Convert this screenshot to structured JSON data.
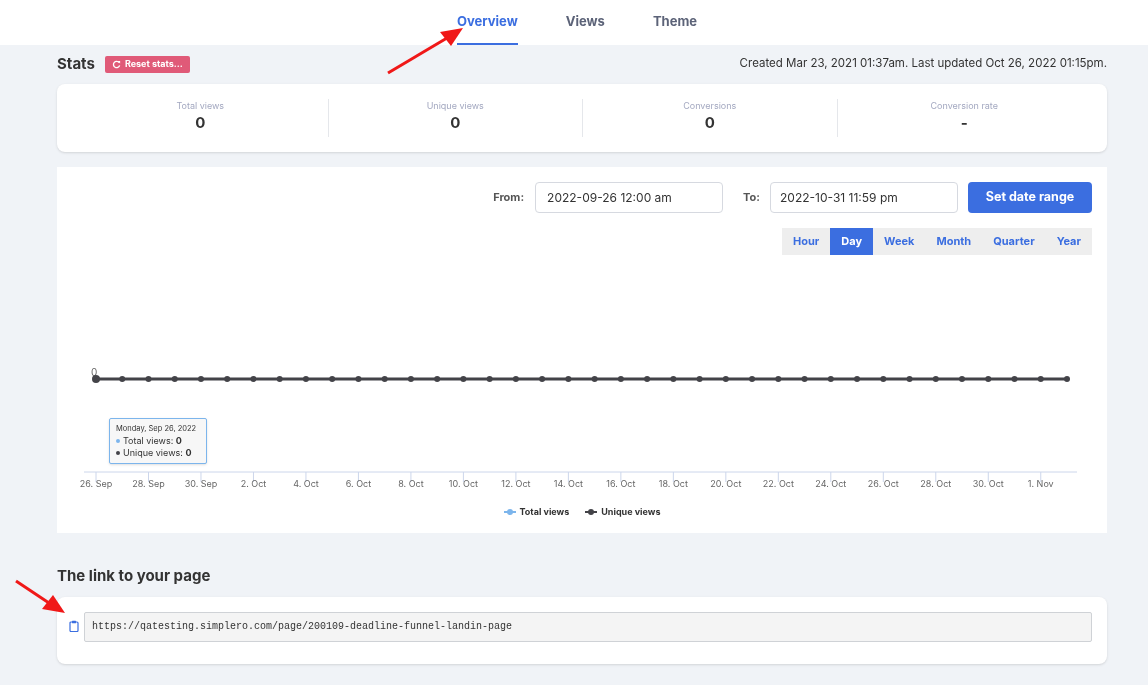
{
  "tabs": [
    {
      "label": "Overview",
      "selected": true
    },
    {
      "label": "Views",
      "selected": false
    },
    {
      "label": "Theme",
      "selected": false
    }
  ],
  "stats": {
    "title": "Stats",
    "reset_button": "Reset stats...",
    "meta": "Created Mar 23, 2021 01:37am. Last updated Oct 26, 2022 01:15pm.",
    "cards": [
      {
        "label": "Total views",
        "value": "0"
      },
      {
        "label": "Unique views",
        "value": "0"
      },
      {
        "label": "Conversions",
        "value": "0"
      },
      {
        "label": "Conversion rate",
        "value": "-"
      }
    ]
  },
  "date_range": {
    "from_label": "From:",
    "from_value": "2022-09-26 12:00 am",
    "to_label": "To:",
    "to_value": "2022-10-31 11:59 pm",
    "button": "Set date range"
  },
  "periods": [
    {
      "label": "Hour",
      "selected": false
    },
    {
      "label": "Day",
      "selected": true
    },
    {
      "label": "Week",
      "selected": false
    },
    {
      "label": "Month",
      "selected": false
    },
    {
      "label": "Quarter",
      "selected": false
    },
    {
      "label": "Year",
      "selected": false
    }
  ],
  "chart": {
    "y_label": "0",
    "x_labels": [
      "26. Sep",
      "28. Sep",
      "30. Sep",
      "2. Oct",
      "4. Oct",
      "6. Oct",
      "8. Oct",
      "10. Oct",
      "12. Oct",
      "14. Oct",
      "16. Oct",
      "18. Oct",
      "20. Oct",
      "22. Oct",
      "24. Oct",
      "26. Oct",
      "28. Oct",
      "30. Oct",
      "1. Nov"
    ],
    "legend": [
      {
        "name": "Total views",
        "color": "#7cb5ec"
      },
      {
        "name": "Unique views",
        "color": "#434348"
      }
    ],
    "tooltip": {
      "title": "Monday, Sep 26, 2022",
      "rows": [
        "Total views: **0**",
        "Unique views: **0**"
      ]
    }
  },
  "link_section": {
    "title": "The link to your page",
    "url": "https://qatesting.simplero.com/page/200109-deadline-funnel-landin-page"
  }
}
